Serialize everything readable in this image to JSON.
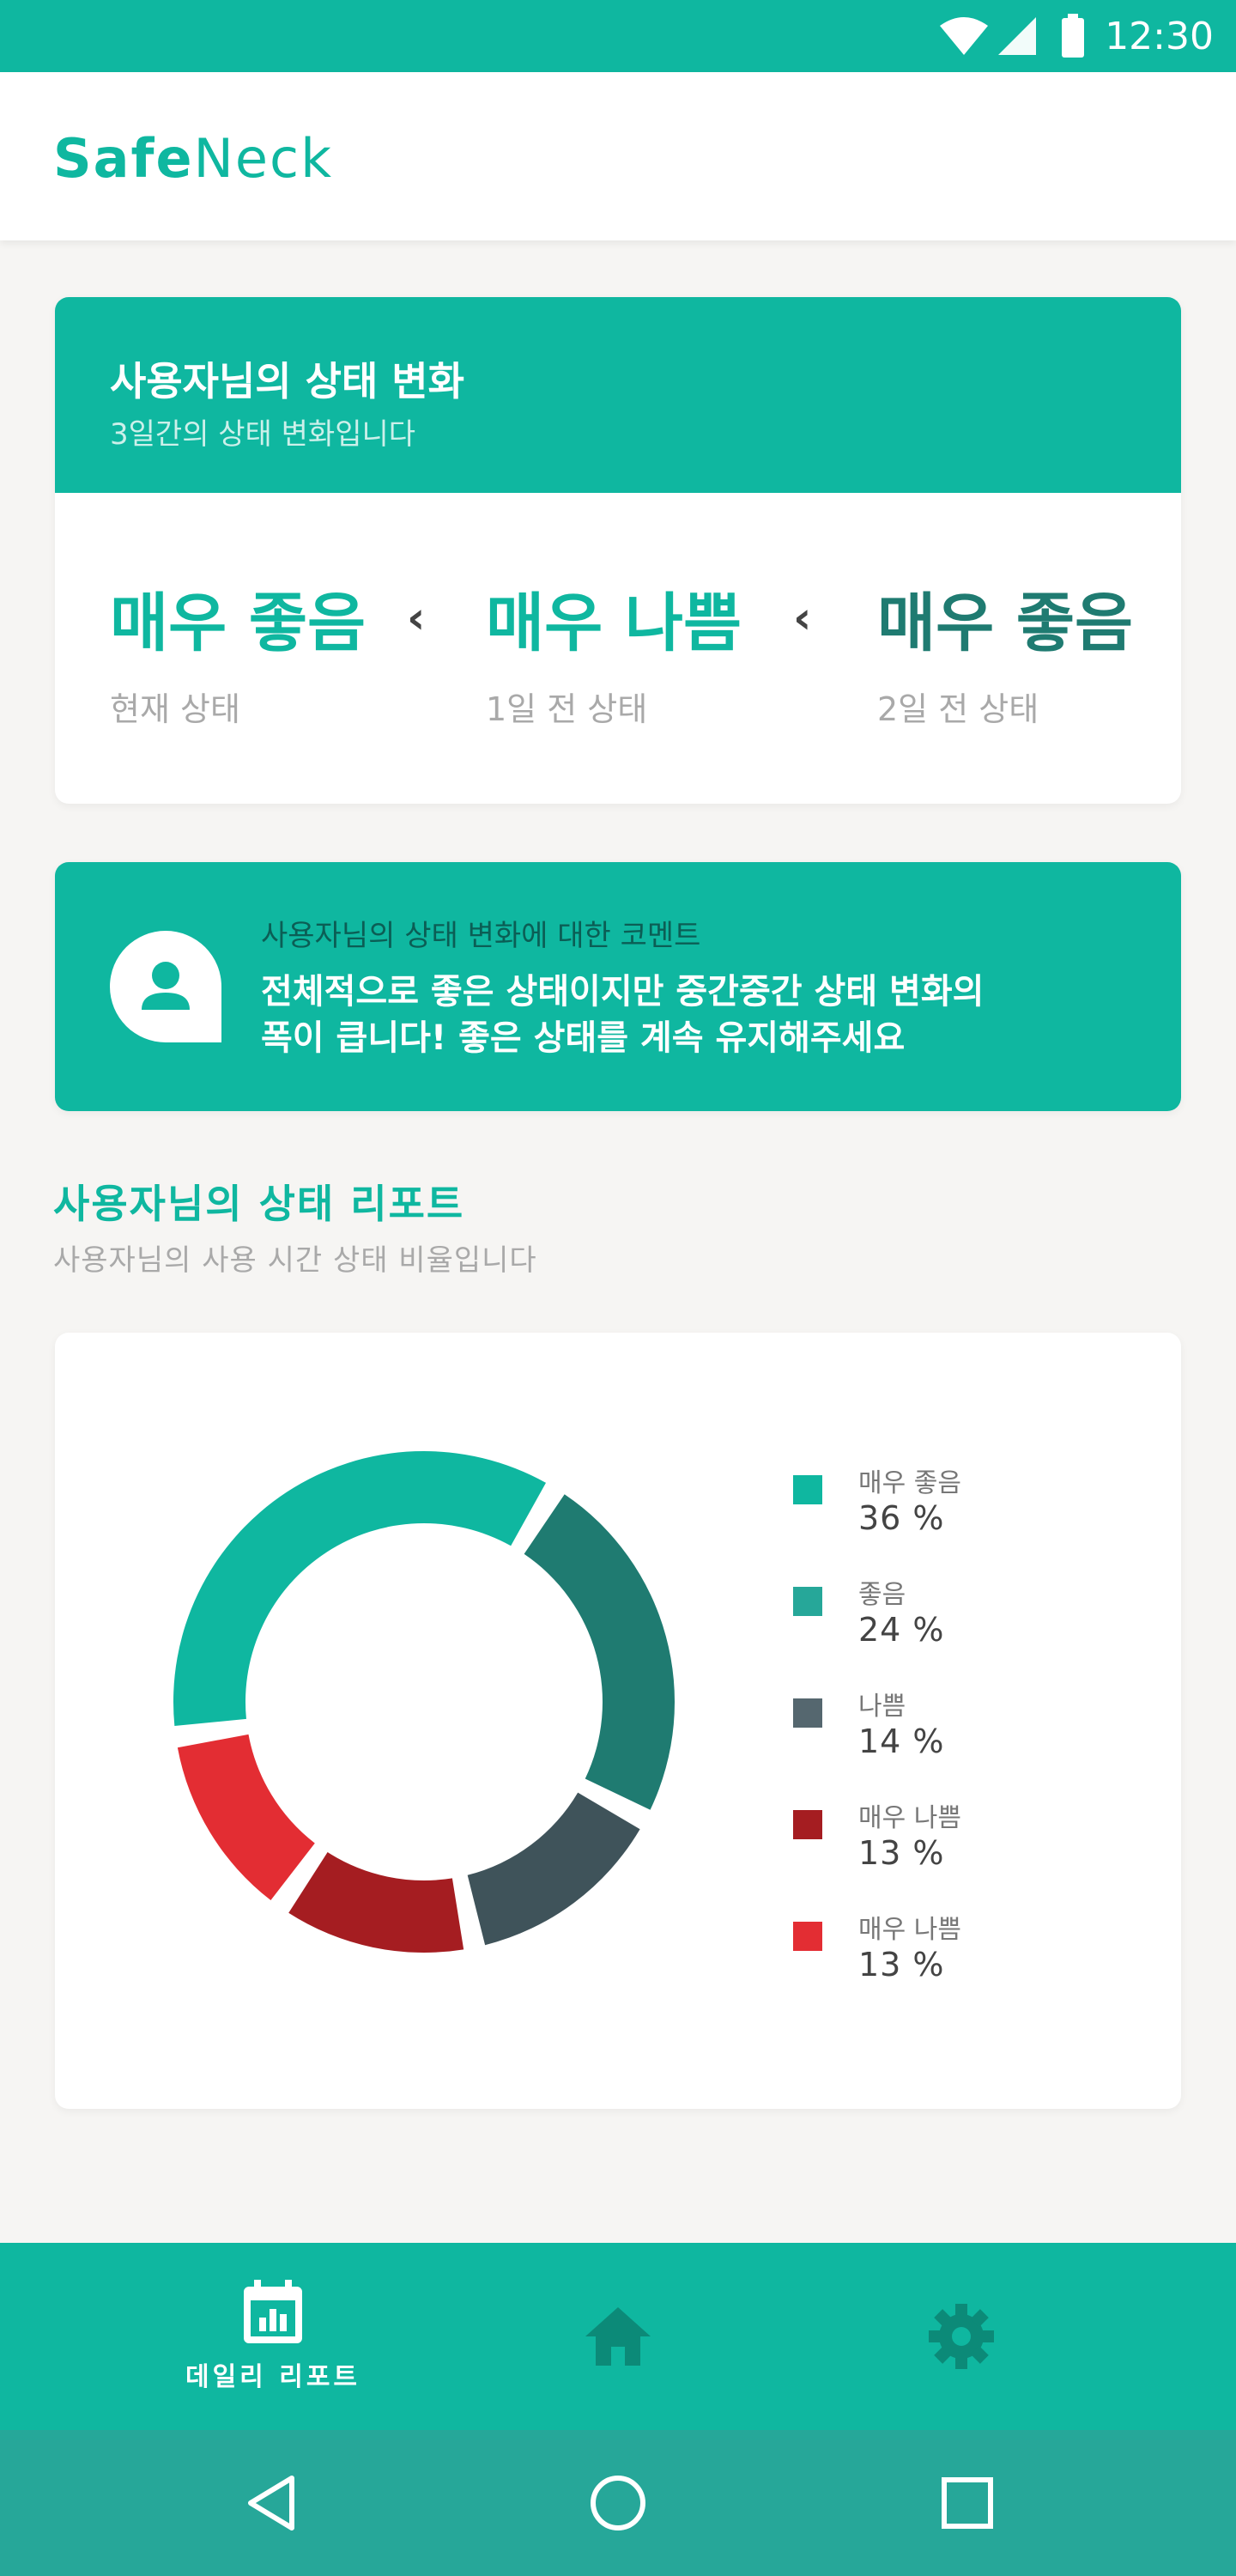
{
  "status_bar": {
    "time": "12:30",
    "icons": [
      "wifi-icon",
      "signal-icon",
      "battery-icon"
    ]
  },
  "app_bar": {
    "brand_part1": "Safe",
    "brand_part2": "Neck"
  },
  "status_change_card": {
    "title": "사용자님의 상태 변화",
    "subtitle": "3일간의 상태 변화입니다",
    "states": [
      {
        "value": "매우 좋음",
        "label": "현재 상태"
      },
      {
        "value": "매우 나쁨",
        "label": "1일 전 상태"
      },
      {
        "value": "매우 좋음",
        "label": "2일 전 상태"
      }
    ],
    "separator": "‹"
  },
  "comment_card": {
    "icon": "user-avatar-icon",
    "title": "사용자님의 상태 변화에 대한 코멘트",
    "text_line1": "전체적으로 좋은 상태이지만 중간중간 상태 변화의",
    "text_line2": "폭이 큽니다! 좋은 상태를 계속 유지해주세요"
  },
  "report_section": {
    "title": "사용자님의 상태 리포트",
    "subtitle": "사용자님의 사용 시간 상태 비율입니다"
  },
  "chart_data": {
    "type": "pie",
    "donut": true,
    "categories": [
      "매우 좋음",
      "좋음",
      "나쁨",
      "매우 나쁨",
      "매우 나쁨"
    ],
    "values": [
      36,
      24,
      14,
      13,
      13
    ],
    "value_labels": [
      "36 %",
      "24 %",
      "14 %",
      "13 %",
      "13 %"
    ],
    "colors": [
      "#0fb7a0",
      "#1f7b71",
      "#3f535a",
      "#a51d21",
      "#e32d33"
    ],
    "legend_colors": [
      "#0fb7a0",
      "#26a799",
      "#55676f",
      "#a51d21",
      "#e32d33"
    ],
    "legend_position": "right"
  },
  "bottom_nav": {
    "items": [
      {
        "label": "데일리 리포트",
        "icon": "calendar-chart-icon",
        "active": true
      },
      {
        "label": "",
        "icon": "home-icon",
        "active": false
      },
      {
        "label": "",
        "icon": "gear-icon",
        "active": false
      }
    ]
  },
  "system_nav": {
    "icons": [
      "back-icon",
      "home-circle-icon",
      "recents-icon"
    ]
  },
  "colors": {
    "primary": "#0fb7a0",
    "dark_teal": "#1f7b71",
    "icon_inactive": "#0c8a78"
  }
}
